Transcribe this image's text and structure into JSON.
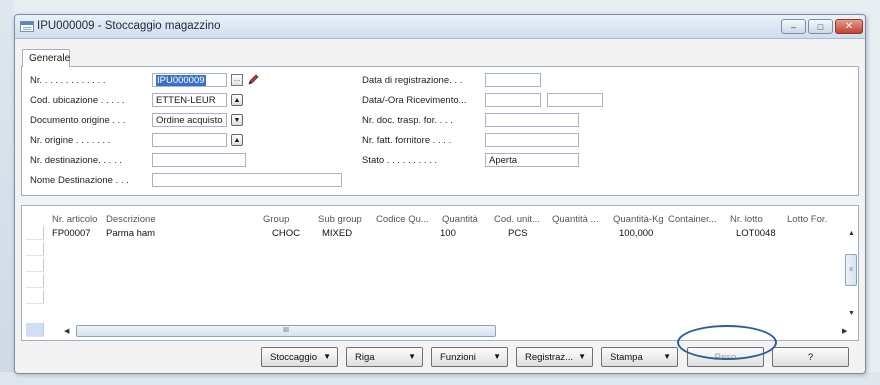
{
  "window": {
    "title": "IPU000009 - Stoccaggio magazzino",
    "controls": {
      "minimize": "–",
      "maximize": "□",
      "close": "✕"
    }
  },
  "tabs": [
    {
      "label": "Generale",
      "active": true
    }
  ],
  "form": {
    "left": [
      {
        "label": "Nr. . . . . . . . . . . . .",
        "value": "IPU000009"
      },
      {
        "label": "Cod. ubicazione . . . . .",
        "value": "ETTEN-LEUR"
      },
      {
        "label": "Documento origine  . . .",
        "value": "Ordine acquisto"
      },
      {
        "label": "Nr. origine . . . . . . .",
        "value": ""
      },
      {
        "label": "Nr. destinazione. . . . .",
        "value": ""
      },
      {
        "label": "Nome Destinazione . . .",
        "value": ""
      }
    ],
    "right": [
      {
        "label": "Data di registrazione. . .",
        "value": ""
      },
      {
        "label": "Data/-Ora Ricevimento...",
        "value": "",
        "value2": ""
      },
      {
        "label": "Nr. doc. trasp. for. . . .",
        "value": ""
      },
      {
        "label": "Nr. fatt. fornitore . . . .",
        "value": ""
      },
      {
        "label": "Stato . . . . . . . . . .",
        "value": "Aperta"
      }
    ]
  },
  "lines": {
    "columns": [
      "Nr. articolo",
      "Descrizione",
      "Group",
      "Sub group",
      "Codice Qu...",
      "Quantità",
      "Cod. unit...",
      "Quantità ...",
      "Quantità-Kg",
      "Container...",
      "Nr. lotto",
      "Lotto For."
    ],
    "rows": [
      [
        "FP00007",
        "Parma ham",
        "CHOC",
        "MIXED",
        "",
        "100",
        "PCS",
        "",
        "100,000",
        "",
        "LOT0048",
        ""
      ]
    ],
    "hscroll_grip": "III",
    "vscroll_grip": "≡"
  },
  "actions": [
    {
      "label": "Stoccaggio",
      "menu": true
    },
    {
      "label": "Riga",
      "menu": true
    },
    {
      "label": "Funzioni",
      "menu": true
    },
    {
      "label": "Registraz...",
      "menu": true
    },
    {
      "label": "Stampa",
      "menu": true
    },
    {
      "label": "Peso",
      "menu": false,
      "enabled": false
    },
    {
      "label": "?",
      "menu": false
    }
  ],
  "colors": {
    "highlight": "#3a71c6",
    "annotation_circle": "#2f5d9c"
  }
}
